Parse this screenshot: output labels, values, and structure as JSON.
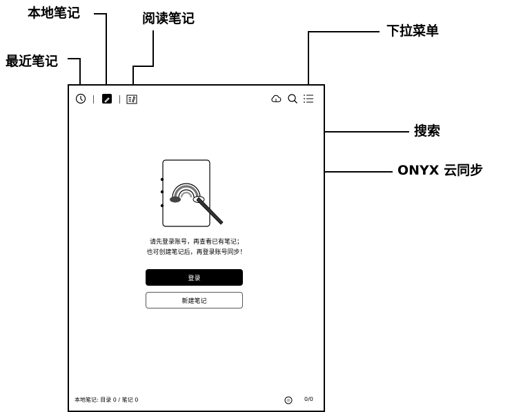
{
  "callouts": {
    "local_notes": "本地笔记",
    "reading_notes": "阅读笔记",
    "recent_notes": "最近笔记",
    "dropdown_menu": "下拉菜单",
    "search": "搜索",
    "cloud_sync": "ONYX 云同步"
  },
  "toolbar": {
    "icons": [
      "clock-icon",
      "pen-icon",
      "book-note-icon",
      "cloud-icon",
      "search-icon",
      "menu-icon"
    ]
  },
  "main": {
    "message_line1": "请先登录账号，再查看已有笔记；",
    "message_line2": "也可创建笔记后，再登录账号同步！",
    "login_label": "登录",
    "new_note_label": "新建笔记"
  },
  "footer": {
    "summary": "本地笔记:  目录 0 / 笔记 0",
    "page": "0/0"
  }
}
